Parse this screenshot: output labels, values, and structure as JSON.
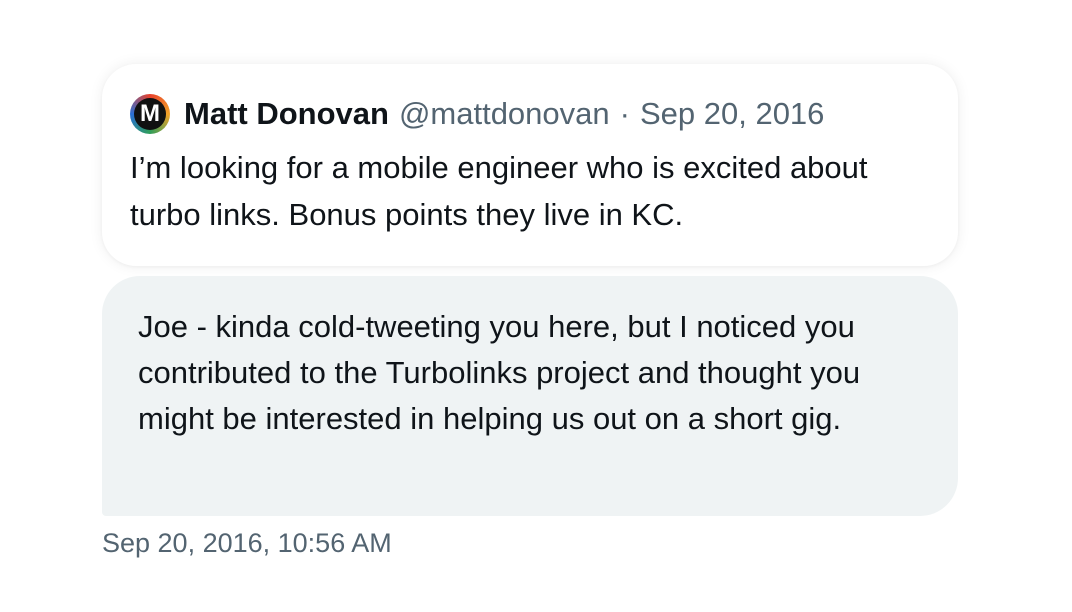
{
  "quoted_tweet": {
    "avatar_letter": "M",
    "author_name": "Matt Donovan",
    "author_handle": "@mattdonovan",
    "separator": "·",
    "date": "Sep 20, 2016",
    "text": "I’m looking for a mobile engineer who is excited about turbo links. Bonus points they live in KC."
  },
  "message": {
    "text": "Joe - kinda cold-tweeting you here, but I noticed you contributed to the Turbolinks project and thought you might be interested in helping us out on a short gig.",
    "timestamp": "Sep 20, 2016, 10:56 AM"
  },
  "colors": {
    "text": "#0f1419",
    "secondary_text": "#536471",
    "bubble_background": "#eff3f4"
  }
}
